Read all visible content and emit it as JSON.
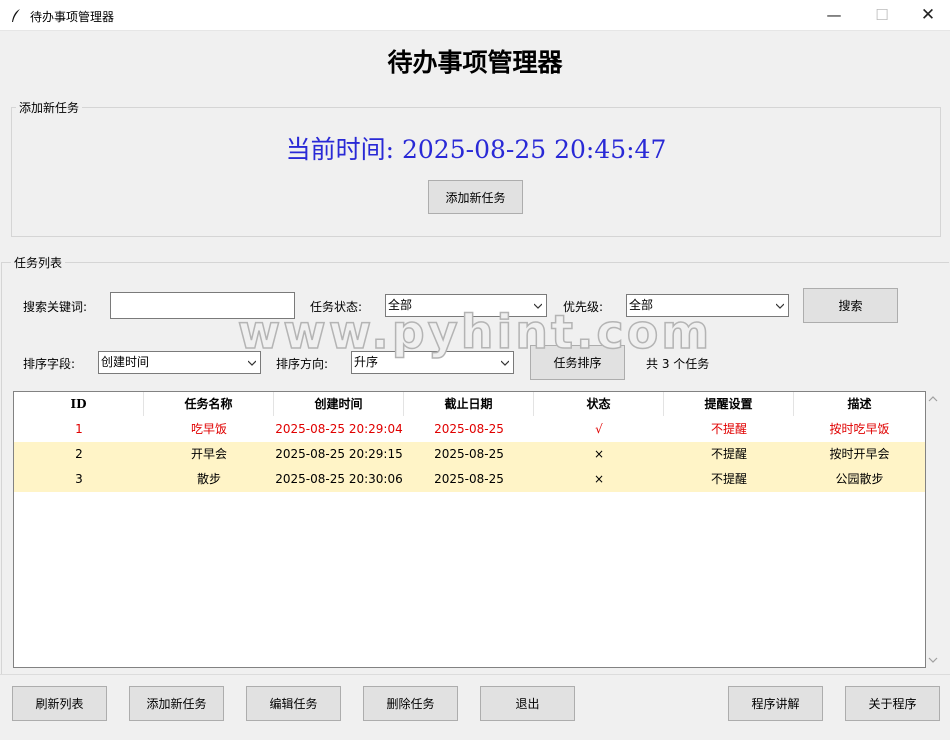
{
  "window": {
    "title": "待办事项管理器",
    "minimize": "—",
    "maximize": "☐",
    "close": "✕"
  },
  "heading": "待办事项管理器",
  "add_group": {
    "title": "添加新任务",
    "clock": "当前时间: 2025-08-25 20:45:47",
    "add_button": "添加新任务"
  },
  "list_group": {
    "title": "任务列表",
    "search_label": "搜索关键词:",
    "search_value": "",
    "status_label": "任务状态:",
    "status_value": "全部",
    "priority_label": "优先级:",
    "priority_value": "全部",
    "search_button": "搜索",
    "sort_field_label": "排序字段:",
    "sort_field_value": "创建时间",
    "sort_dir_label": "排序方向:",
    "sort_dir_value": "升序",
    "sort_button": "任务排序",
    "count_text": "共 3 个任务"
  },
  "watermark": "www.pyhint.com",
  "table": {
    "columns": [
      "ID",
      "任务名称",
      "创建时间",
      "截止日期",
      "状态",
      "提醒设置",
      "描述"
    ],
    "rows": [
      [
        "1",
        "吃早饭",
        "2025-08-25 20:29:04",
        "2025-08-25",
        "√",
        "不提醒",
        "按时吃早饭"
      ],
      [
        "2",
        "开早会",
        "2025-08-25 20:29:15",
        "2025-08-25",
        "×",
        "不提醒",
        "按时开早会"
      ],
      [
        "3",
        "散步",
        "2025-08-25 20:30:06",
        "2025-08-25",
        "×",
        "不提醒",
        "公园散步"
      ]
    ],
    "row_styles": [
      "red",
      "yellow",
      "yellow"
    ]
  },
  "bottom_buttons": {
    "refresh": "刷新列表",
    "add": "添加新任务",
    "edit": "编辑任务",
    "delete": "删除任务",
    "exit": "退出",
    "explain": "程序讲解",
    "about": "关于程序"
  },
  "colors": {
    "clock": "#2929d6",
    "done_row": "#e00000",
    "pending_row_bg": "#fff4c7"
  }
}
